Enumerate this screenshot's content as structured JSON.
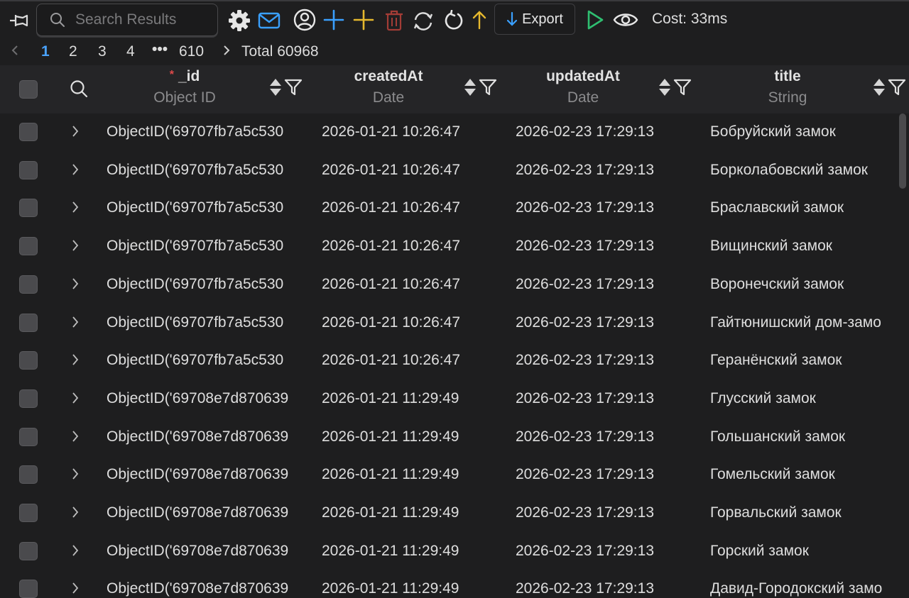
{
  "toolbar": {
    "search_placeholder": "Search Results",
    "export_label": "Export",
    "cost_text": "Cost: 33ms",
    "icons": [
      "pin-icon",
      "search-icon",
      "gear-icon",
      "mail-icon",
      "user-circle-icon",
      "add-row-icon",
      "add-field-icon",
      "delete-icon",
      "sync-icon",
      "refresh-icon",
      "up-arrow-icon",
      "export-down-arrow-icon",
      "run-icon",
      "eye-icon"
    ],
    "colors": {
      "accent_blue": "#3aa0ff",
      "add_field_yellow": "#e5b82e",
      "delete_red": "#a33c36",
      "run_green": "#2fbf71"
    }
  },
  "pagination": {
    "pages": [
      "1",
      "2",
      "3",
      "4"
    ],
    "ellipsis": "•••",
    "last_page": "610",
    "total_text": "Total 60968",
    "active_page": "1"
  },
  "columns": [
    {
      "name": "_id",
      "type": "Object ID",
      "required": true
    },
    {
      "name": "createdAt",
      "type": "Date",
      "required": false
    },
    {
      "name": "updatedAt",
      "type": "Date",
      "required": false
    },
    {
      "name": "title",
      "type": "String",
      "required": false
    }
  ],
  "required_marker": "*",
  "rows": [
    {
      "id": "ObjectID('69707fb7a5c530",
      "createdAt": "2026-01-21 10:26:47",
      "updatedAt": "2026-02-23 17:29:13",
      "title": "Бобруйский замок"
    },
    {
      "id": "ObjectID('69707fb7a5c530",
      "createdAt": "2026-01-21 10:26:47",
      "updatedAt": "2026-02-23 17:29:13",
      "title": "Борколабовский замок"
    },
    {
      "id": "ObjectID('69707fb7a5c530",
      "createdAt": "2026-01-21 10:26:47",
      "updatedAt": "2026-02-23 17:29:13",
      "title": "Браславский замок"
    },
    {
      "id": "ObjectID('69707fb7a5c530",
      "createdAt": "2026-01-21 10:26:47",
      "updatedAt": "2026-02-23 17:29:13",
      "title": "Вищинский замок"
    },
    {
      "id": "ObjectID('69707fb7a5c530",
      "createdAt": "2026-01-21 10:26:47",
      "updatedAt": "2026-02-23 17:29:13",
      "title": "Воронечский замок"
    },
    {
      "id": "ObjectID('69707fb7a5c530",
      "createdAt": "2026-01-21 10:26:47",
      "updatedAt": "2026-02-23 17:29:13",
      "title": "Гайтюнишский дом-замо"
    },
    {
      "id": "ObjectID('69707fb7a5c530",
      "createdAt": "2026-01-21 10:26:47",
      "updatedAt": "2026-02-23 17:29:13",
      "title": "Геранёнский замок"
    },
    {
      "id": "ObjectID('69708e7d870639",
      "createdAt": "2026-01-21 11:29:49",
      "updatedAt": "2026-02-23 17:29:13",
      "title": "Глусский замок"
    },
    {
      "id": "ObjectID('69708e7d870639",
      "createdAt": "2026-01-21 11:29:49",
      "updatedAt": "2026-02-23 17:29:13",
      "title": "Гольшанский замок"
    },
    {
      "id": "ObjectID('69708e7d870639",
      "createdAt": "2026-01-21 11:29:49",
      "updatedAt": "2026-02-23 17:29:13",
      "title": "Гомельский замок"
    },
    {
      "id": "ObjectID('69708e7d870639",
      "createdAt": "2026-01-21 11:29:49",
      "updatedAt": "2026-02-23 17:29:13",
      "title": "Горвальский замок"
    },
    {
      "id": "ObjectID('69708e7d870639",
      "createdAt": "2026-01-21 11:29:49",
      "updatedAt": "2026-02-23 17:29:13",
      "title": "Горский замок"
    },
    {
      "id": "ObjectID('69708e7d870639",
      "createdAt": "2026-01-21 11:29:49",
      "updatedAt": "2026-02-23 17:29:13",
      "title": "Давид-Городокский замо"
    }
  ]
}
